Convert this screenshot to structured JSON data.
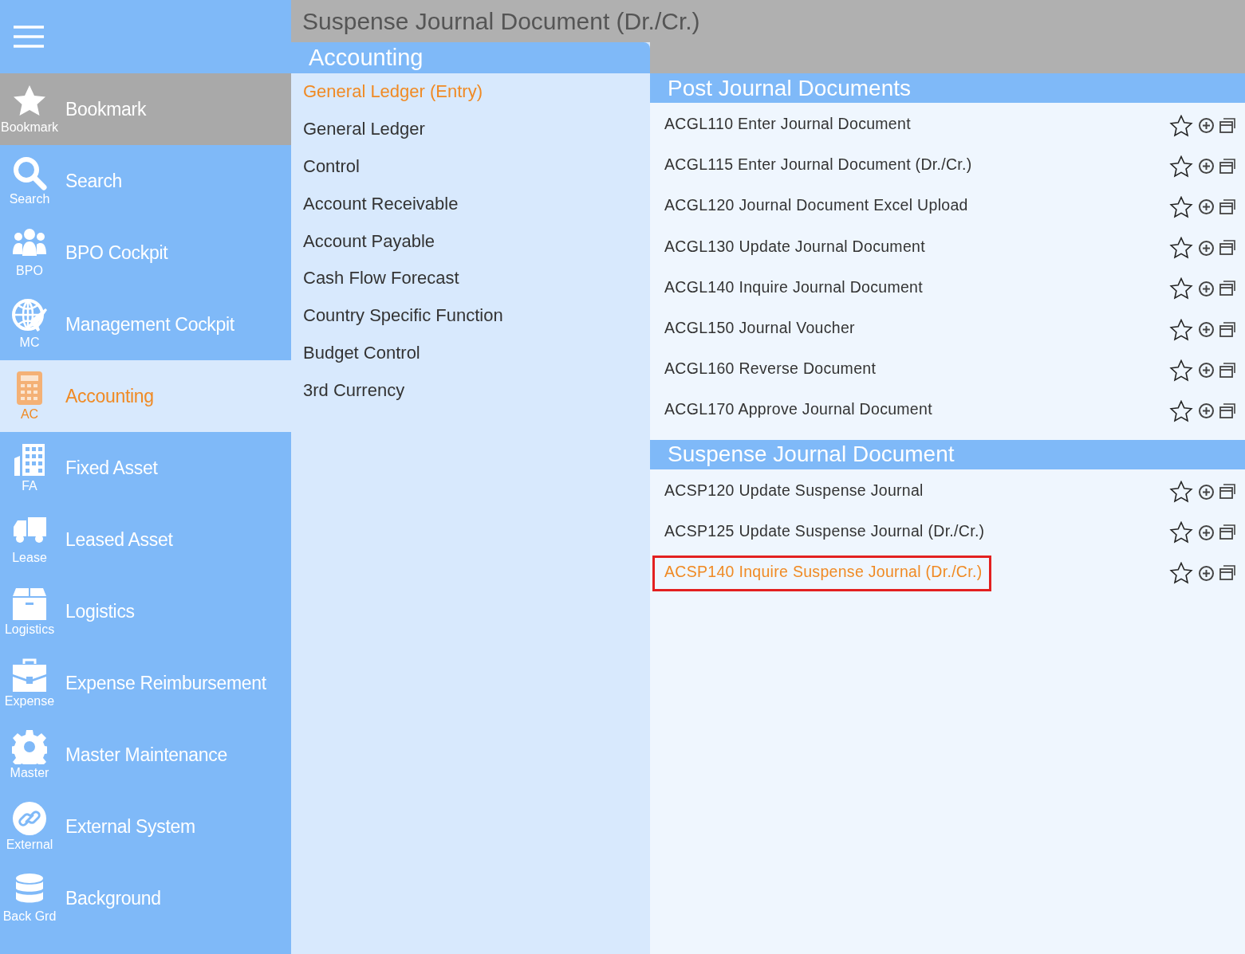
{
  "page_title": "Suspense Journal Document (Dr./Cr.)",
  "sidebar": {
    "items": [
      {
        "label": "Bookmark",
        "short": "Bookmark",
        "selected": false,
        "highlighted": true
      },
      {
        "label": "Search",
        "short": "Search",
        "selected": false,
        "highlighted": false
      },
      {
        "label": "BPO Cockpit",
        "short": "BPO",
        "selected": false,
        "highlighted": false
      },
      {
        "label": "Management Cockpit",
        "short": "MC",
        "selected": false,
        "highlighted": false
      },
      {
        "label": "Accounting",
        "short": "AC",
        "selected": true,
        "highlighted": false
      },
      {
        "label": "Fixed Asset",
        "short": "FA",
        "selected": false,
        "highlighted": false
      },
      {
        "label": "Leased Asset",
        "short": "Lease",
        "selected": false,
        "highlighted": false
      },
      {
        "label": "Logistics",
        "short": "Logistics",
        "selected": false,
        "highlighted": false
      },
      {
        "label": "Expense Reimbursement",
        "short": "Expense",
        "selected": false,
        "highlighted": false
      },
      {
        "label": "Master Maintenance",
        "short": "Master",
        "selected": false,
        "highlighted": false
      },
      {
        "label": "External System",
        "short": "External",
        "selected": false,
        "highlighted": false
      },
      {
        "label": "Background",
        "short": "Back Grd",
        "selected": false,
        "highlighted": false
      }
    ]
  },
  "menu": {
    "title": "Accounting",
    "items": [
      {
        "label": "General Ledger (Entry)",
        "selected": true
      },
      {
        "label": "General Ledger",
        "selected": false
      },
      {
        "label": "Control",
        "selected": false
      },
      {
        "label": "Account Receivable",
        "selected": false
      },
      {
        "label": "Account Payable",
        "selected": false
      },
      {
        "label": "Cash Flow Forecast",
        "selected": false
      },
      {
        "label": "Country Specific Function",
        "selected": false
      },
      {
        "label": "Budget Control",
        "selected": false
      },
      {
        "label": "3rd Currency",
        "selected": false
      }
    ]
  },
  "sections": [
    {
      "title": "Post Journal Documents",
      "rows": [
        {
          "label": "ACGL110 Enter Journal Document",
          "selected": false
        },
        {
          "label": "ACGL115 Enter Journal Document (Dr./Cr.)",
          "selected": false
        },
        {
          "label": "ACGL120 Journal Document Excel Upload",
          "selected": false
        },
        {
          "label": "ACGL130 Update Journal Document",
          "selected": false
        },
        {
          "label": "ACGL140 Inquire Journal Document",
          "selected": false
        },
        {
          "label": "ACGL150 Journal Voucher",
          "selected": false
        },
        {
          "label": "ACGL160 Reverse Document",
          "selected": false
        },
        {
          "label": "ACGL170 Approve Journal Document",
          "selected": false
        }
      ]
    },
    {
      "title": "Suspense Journal Document",
      "rows": [
        {
          "label": "ACSP120 Update Suspense Journal",
          "selected": false
        },
        {
          "label": "ACSP125 Update Suspense Journal (Dr./Cr.)",
          "selected": false
        },
        {
          "label": "ACSP140 Inquire Suspense Journal (Dr./Cr.)",
          "selected": true
        }
      ]
    }
  ]
}
